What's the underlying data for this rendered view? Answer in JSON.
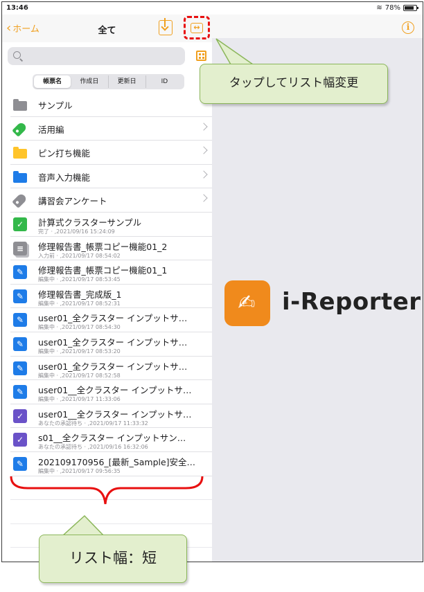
{
  "status_bar": {
    "time": "13:46",
    "battery": "78%"
  },
  "nav": {
    "back_label": "ホーム",
    "title": "全て"
  },
  "search": {
    "placeholder": ""
  },
  "segments": [
    "帳票名",
    "作成日",
    "更新日",
    "ID"
  ],
  "folders": [
    {
      "label": "サンプル"
    },
    {
      "label": "活用編"
    },
    {
      "label": "ピン打ち機能"
    },
    {
      "label": "音声入力機能"
    },
    {
      "label": "講習会アンケート"
    }
  ],
  "files": [
    {
      "title": "計算式クラスターサンプル",
      "sub": "完了 · ,2021/09/16 15:24:09"
    },
    {
      "title": "修理報告書_帳票コピー機能01_2",
      "sub": "入力前 · ,2021/09/17 08:54:02"
    },
    {
      "title": "修理報告書_帳票コピー機能01_1",
      "sub": "編集中 · ,2021/09/17 08:53:45"
    },
    {
      "title": "修理報告書_完成版_1",
      "sub": "編集中 · ,2021/09/17 08:52:31"
    },
    {
      "title": "user01_全クラスター インプットサ…",
      "sub": "編集中 · ,2021/09/17 08:54:30"
    },
    {
      "title": "user01_全クラスター インプットサ…",
      "sub": "編集中 · ,2021/09/17 08:53:20"
    },
    {
      "title": "user01_全クラスター インプットサ…",
      "sub": "編集中 · ,2021/09/17 08:52:58"
    },
    {
      "title": "user01__全クラスター インプットサ…",
      "sub": "編集中 · ,2021/09/17 11:33:06"
    },
    {
      "title": "user01__全クラスター インプットサ…",
      "sub": "あなたの承認待ち · ,2021/09/17 11:33:32"
    },
    {
      "title": "s01__全クラスター インプットサン…",
      "sub": "あなたの承認待ち · ,2021/09/16 16:32:06"
    },
    {
      "title": "202109170956_[最新_Sample]安全…",
      "sub": "編集中 · ,2021/09/17 09:56:35"
    }
  ],
  "brand": {
    "name": "i-Reporter",
    "accent": "#f0a020",
    "logo_bg": "#f08a1c"
  },
  "annotations": {
    "tap_hint": "タップしてリスト幅変更",
    "width_label": "リスト幅：短"
  }
}
